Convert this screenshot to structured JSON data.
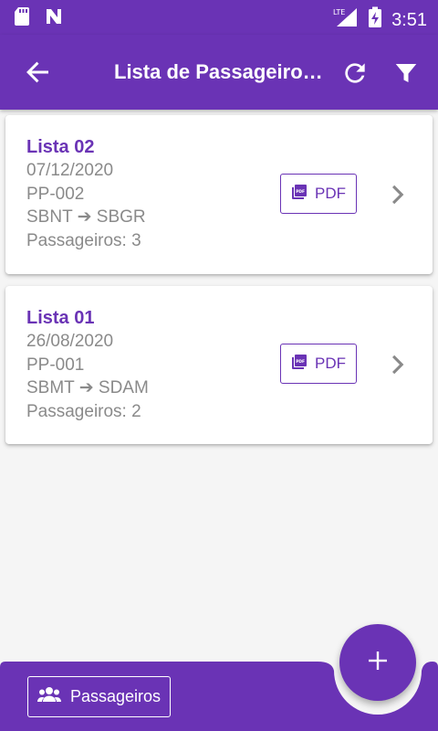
{
  "status_bar": {
    "time": "3:51",
    "network": "LTE",
    "icons": [
      "sd-card-icon",
      "n-notification-icon",
      "lte-signal-icon",
      "battery-charging-icon"
    ]
  },
  "app_bar": {
    "title": "Lista de Passageiro…",
    "icons": [
      "back-arrow-icon",
      "refresh-icon",
      "filter-icon"
    ]
  },
  "lists": [
    {
      "name": "Lista 02",
      "date": "07/12/2020",
      "code": "PP-002",
      "route": "SBNT ➔ SBGR",
      "passengers": "Passageiros: 3",
      "pdf_label": "PDF"
    },
    {
      "name": "Lista 01",
      "date": "26/08/2020",
      "code": "PP-001",
      "route": "SBMT ➔ SDAM",
      "passengers": "Passageiros: 2",
      "pdf_label": "PDF"
    }
  ],
  "bottom_bar": {
    "passengers_button": "Passageiros",
    "fab_icon": "plus-icon"
  },
  "colors": {
    "primary": "#6a33b5",
    "background": "#f5f5f5",
    "secondary_text": "#8a8a8a"
  }
}
